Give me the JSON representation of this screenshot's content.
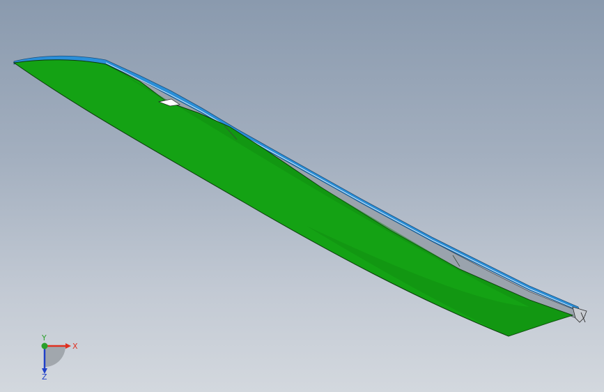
{
  "viewport": {
    "background_top": "#8a9aae",
    "background_bottom": "#d3d8de"
  },
  "model": {
    "face_color": "#14a214",
    "edge_color": "#0d3a0d",
    "rail_blue": "#2a8fd8",
    "rail_gray": "#9aa3ad"
  },
  "triad": {
    "x_label": "X",
    "y_label": "Y",
    "z_label": "Z",
    "x_color": "#e03020",
    "y_color": "#2aa02a",
    "z_color": "#2040c8"
  }
}
